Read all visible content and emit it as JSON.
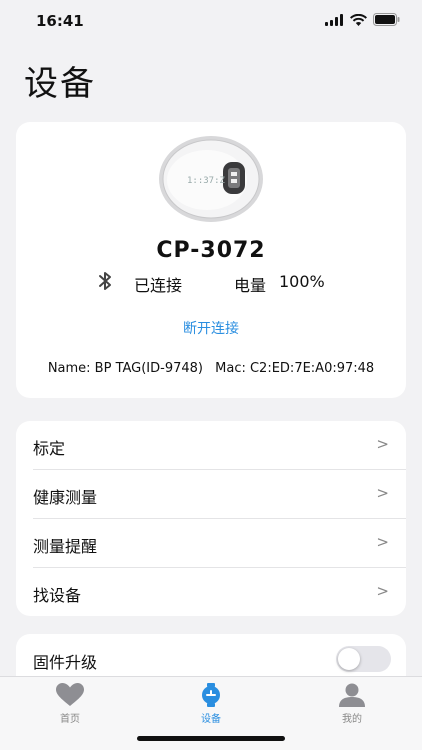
{
  "status_bar": {
    "time": "16:41",
    "icons": [
      "signal-icon",
      "wifi-icon",
      "battery-icon"
    ]
  },
  "page_title": "设备",
  "device": {
    "name": "CP-3072",
    "connection_status": "已连接",
    "battery_label": "电量",
    "battery_value": "100%",
    "disconnect_label": "断开连接",
    "info_name": "Name: BP TAG(ID-9748)",
    "info_mac": "Mac: C2:ED:7E:A0:97:48",
    "image_icon": "device-image"
  },
  "menu": {
    "items": [
      {
        "label": "标定",
        "chevron": ">"
      },
      {
        "label": "健康测量",
        "chevron": ">"
      },
      {
        "label": "测量提醒",
        "chevron": ">"
      },
      {
        "label": "找设备",
        "chevron": ">"
      }
    ]
  },
  "firmware": {
    "label": "固件升级",
    "toggle_on": false
  },
  "tabs": [
    {
      "label": "首页",
      "icon": "heart-icon",
      "active": false
    },
    {
      "label": "设备",
      "icon": "watch-icon",
      "active": true
    },
    {
      "label": "我的",
      "icon": "person-icon",
      "active": false
    }
  ],
  "colors": {
    "accent": "#2a8ee0",
    "background": "#f2f2f4",
    "card": "#ffffff"
  }
}
